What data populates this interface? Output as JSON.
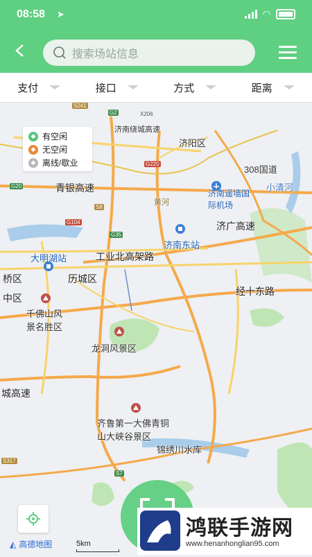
{
  "status": {
    "time": "08:58"
  },
  "header": {
    "back_label": "<",
    "search_placeholder": "搜索场站信息"
  },
  "filters": [
    "支付",
    "接口",
    "方式",
    "距离"
  ],
  "legend": [
    {
      "label": "有空闲",
      "color": "#5bc47f"
    },
    {
      "label": "无空闲",
      "color": "#e88a3a"
    },
    {
      "label": "离线/歇业",
      "color": "#b8b8b8"
    }
  ],
  "map": {
    "labels": [
      "济阳区",
      "308国道",
      "小清河",
      "济南遥墙国际机场",
      "青银高速",
      "济南东站",
      "大明湖站",
      "工业北高架路",
      "济广高速",
      "历城区",
      "桥区",
      "中区",
      "千佛山风景名胜区",
      "经十东路",
      "龙洞风景区",
      "城高速",
      "齐鲁第一大佛青铜山大峡谷景区",
      "锦绣川水库",
      "黄河",
      "济南绕城高速"
    ],
    "road_tags": [
      "S241",
      "G2",
      "X206",
      "G20",
      "G220",
      "S8",
      "G104",
      "G35",
      "S317",
      "S7"
    ],
    "attribution": "高德地图",
    "scale_label": "5km"
  },
  "watermark": {
    "title": "鸿联手游网",
    "url": "www.henanhonglian95.com"
  }
}
